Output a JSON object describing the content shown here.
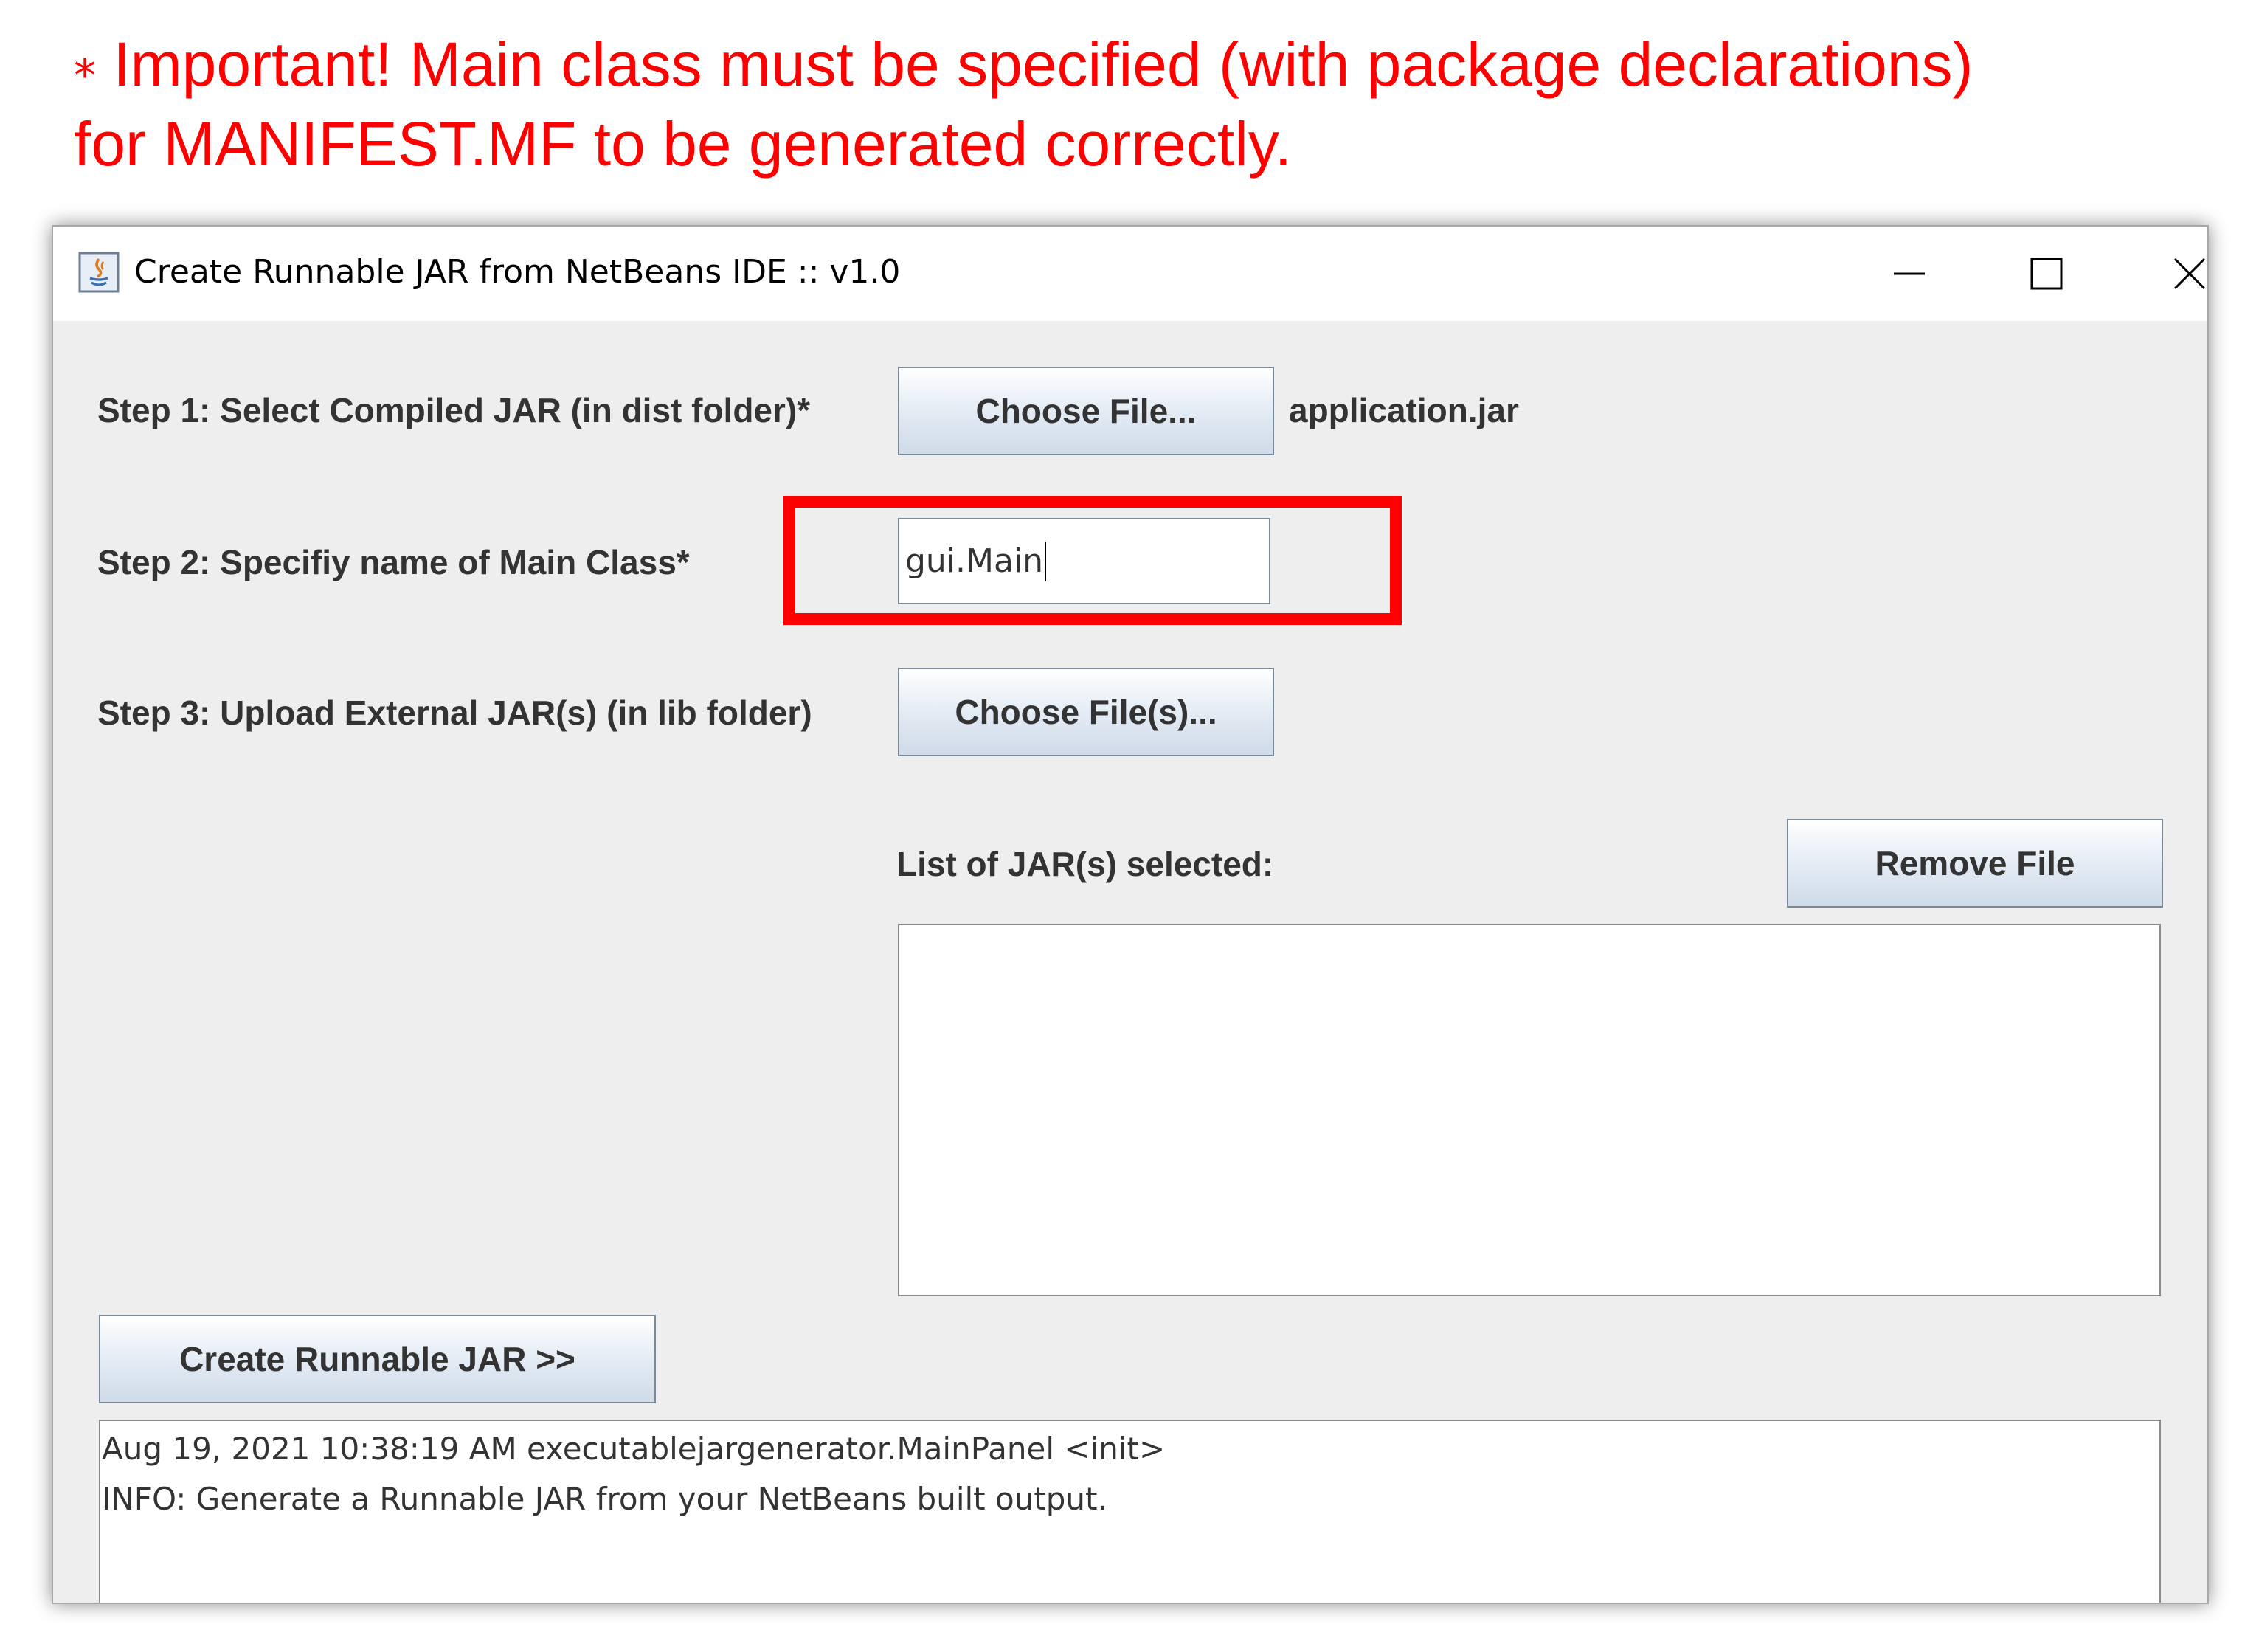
{
  "annotation": {
    "star": "⁎",
    "text_line1": "Important! Main class must be specified (with package declarations)",
    "text_line2": "for MANIFEST.MF to be generated correctly.",
    "color": "#ff0000"
  },
  "window": {
    "title": "Create Runnable JAR from NetBeans IDE :: v1.0",
    "app_icon": "java-icon",
    "controls": [
      "minimize-icon",
      "maximize-icon",
      "close-icon"
    ]
  },
  "step1": {
    "label": "Step 1: Select Compiled JAR (in dist folder)*",
    "button": "Choose File...",
    "selected_file": "application.jar"
  },
  "step2": {
    "label": "Step 2: Specifiy name of Main Class*",
    "value": "gui.Main",
    "highlight_color": "#ff0000"
  },
  "step3": {
    "label": "Step 3: Upload External JAR(s) (in lib folder)",
    "button": "Choose File(s)..."
  },
  "jar_list": {
    "label": "List of JAR(s) selected:",
    "remove_button": "Remove File",
    "items": []
  },
  "create_button": "Create Runnable JAR >>",
  "log": {
    "lines": [
      "Aug 19, 2021 10:38:19 AM executablejargenerator.MainPanel <init>",
      "INFO: Generate a Runnable JAR from your NetBeans built output."
    ]
  }
}
